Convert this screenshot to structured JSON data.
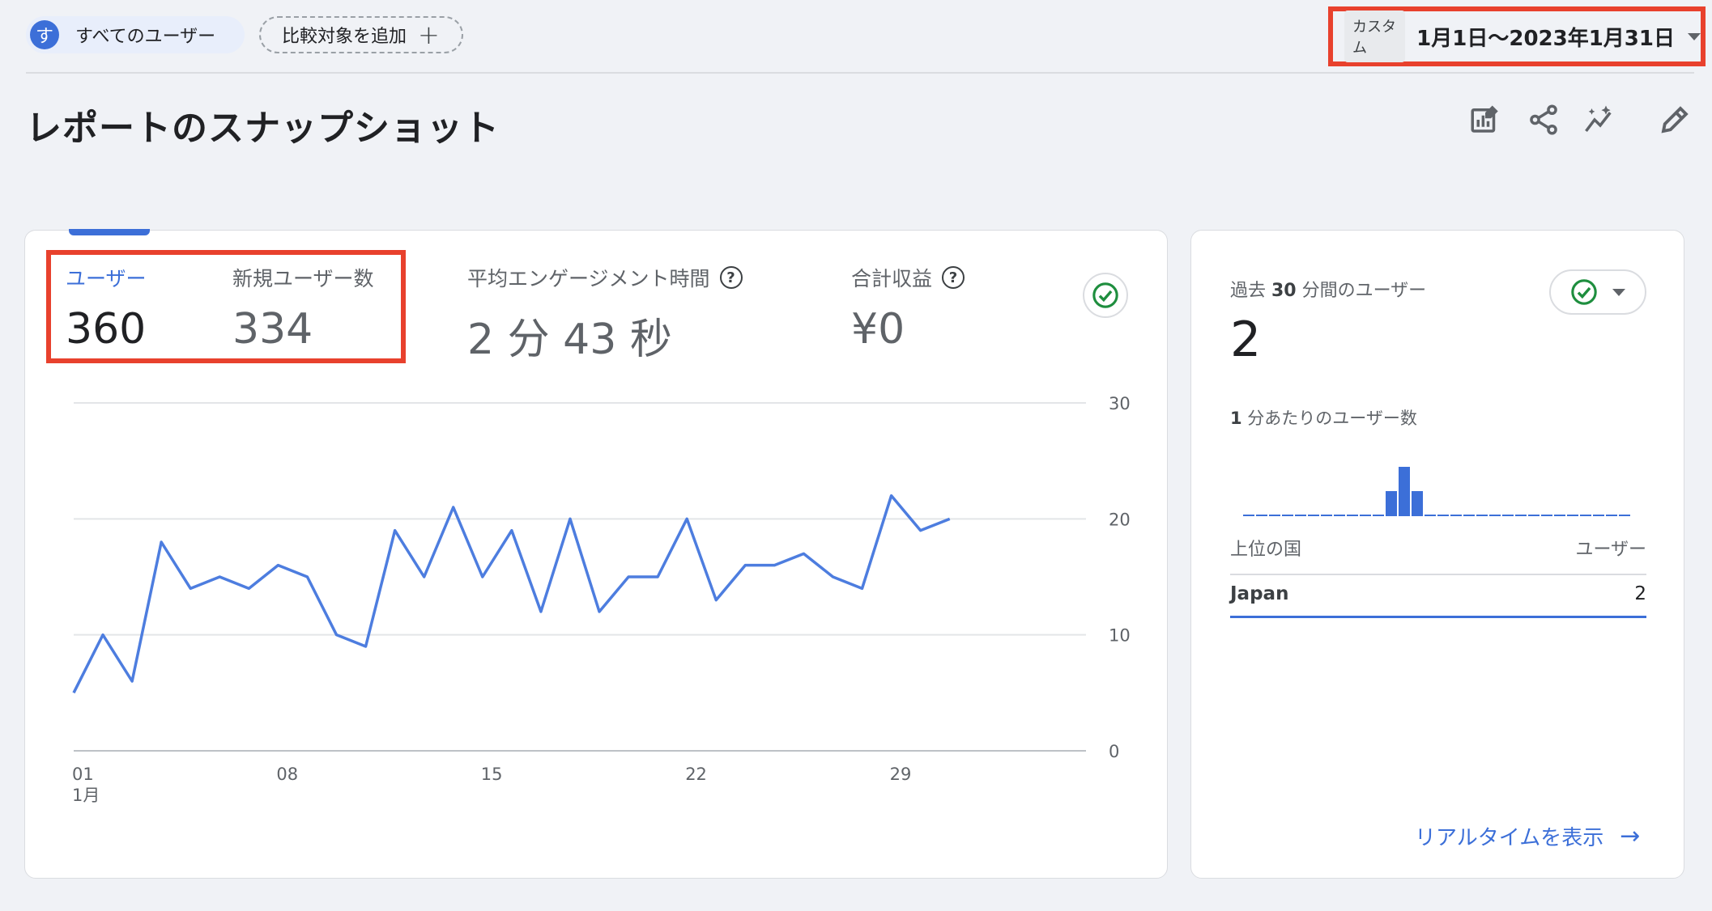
{
  "topbar": {
    "segment_avatar": "す",
    "segment_label": "すべてのユーザー",
    "add_compare_label": "比較対象を追加",
    "date_tag": "カスタム",
    "date_range": "1月1日〜2023年1月31日"
  },
  "page": {
    "title": "レポートのスナップショット"
  },
  "toolbar_icons": [
    "customize-report-icon",
    "share-icon",
    "insights-icon",
    "edit-icon"
  ],
  "kpis": [
    {
      "label": "ユーザー",
      "value": "360",
      "active": true
    },
    {
      "label": "新規ユーザー数",
      "value": "334",
      "active": false
    },
    {
      "label": "平均エンゲージメント時間",
      "value": "2 分 43 秒",
      "active": false
    },
    {
      "label": "合計収益",
      "value": "¥0",
      "active": false
    }
  ],
  "help_glyph": "?",
  "colors": {
    "accent": "#3c6fd8",
    "highlight_red": "#e8412d",
    "status_green": "#1e8e3e"
  },
  "chart_data": {
    "type": "line",
    "x": [
      1,
      2,
      3,
      4,
      5,
      6,
      7,
      8,
      9,
      10,
      11,
      12,
      13,
      14,
      15,
      16,
      17,
      18,
      19,
      20,
      21,
      22,
      23,
      24,
      25,
      26,
      27,
      28,
      29,
      30,
      31
    ],
    "x_tick_labels": [
      "01",
      "08",
      "15",
      "22",
      "29"
    ],
    "x_tick_days": [
      1,
      8,
      15,
      22,
      29
    ],
    "x_month_label": "1月",
    "y_tick_labels": [
      "30",
      "20",
      "10",
      "0"
    ],
    "ylim": [
      0,
      30
    ],
    "series": [
      {
        "values": [
          5,
          10,
          6,
          18,
          14,
          15,
          14,
          16,
          15,
          10,
          9,
          19,
          15,
          21,
          15,
          19,
          12,
          20,
          12,
          15,
          15,
          20,
          13,
          16,
          16,
          17,
          15,
          14,
          22,
          19,
          20
        ],
        "color": "#4d7ddf"
      }
    ],
    "grid": true
  },
  "realtime": {
    "title_prefix": "過去 ",
    "title_number": "30",
    "title_suffix": " 分間のユーザー",
    "value": "2",
    "per_minute_prefix": "",
    "per_minute_number": "1",
    "per_minute_suffix": " 分あたりのユーザー数",
    "minute_bars": [
      0,
      0,
      0,
      0,
      0,
      0,
      0,
      0,
      0,
      0,
      0,
      1,
      2,
      1,
      0,
      0,
      0,
      0,
      0,
      0,
      0,
      0,
      0,
      0,
      0,
      0,
      0,
      0,
      0,
      0
    ],
    "table_header_left": "上位の国",
    "table_header_right": "ユーザー",
    "rows": [
      {
        "country": "Japan",
        "users": "2"
      }
    ],
    "link_label": "リアルタイムを表示"
  }
}
